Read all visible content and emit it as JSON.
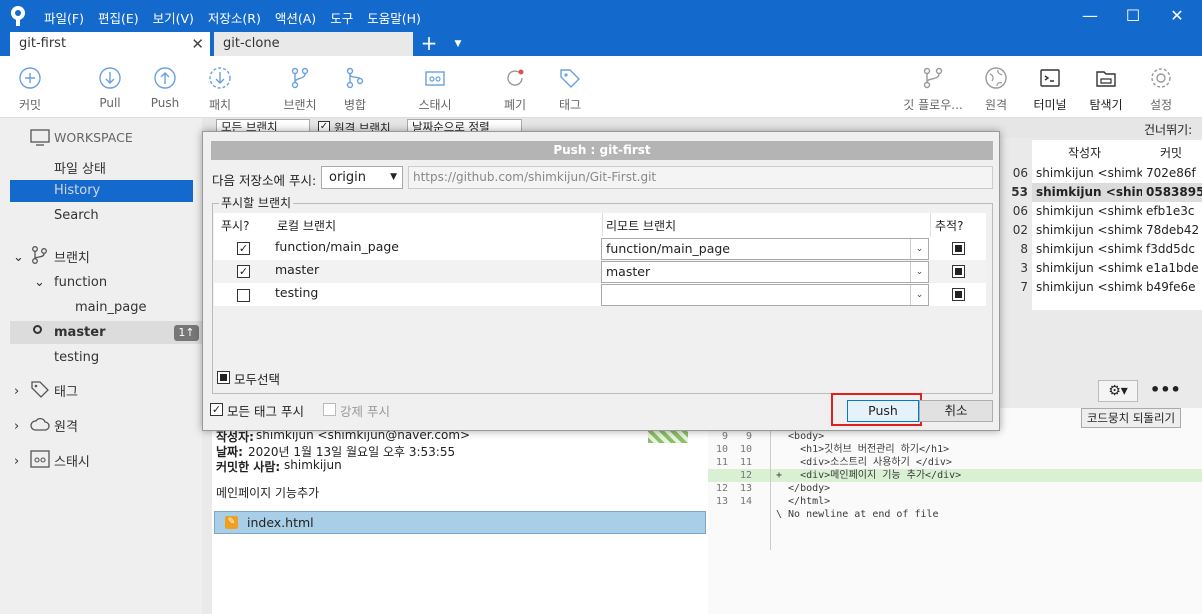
{
  "menu": [
    "파일(F)",
    "편집(E)",
    "보기(V)",
    "저장소(R)",
    "액션(A)",
    "도구",
    "도움말(H)"
  ],
  "tabs": {
    "active": "git-first",
    "inactive": "git-clone"
  },
  "toolbar": {
    "commit": "커밋",
    "pull": "Pull",
    "push": "Push",
    "fetch": "패치",
    "branch": "브랜치",
    "merge": "병합",
    "stash": "스태시",
    "discard": "폐기",
    "tag": "태그",
    "gitflow": "깃 플로우...",
    "remote": "원격",
    "terminal": "터미널",
    "explorer": "탐색기",
    "settings": "설정"
  },
  "sidebar": {
    "workspace": "WORKSPACE",
    "file_status": "파일 상태",
    "history": "History",
    "search": "Search",
    "branches": "브랜치",
    "function": "function",
    "main_page": "main_page",
    "master": "master",
    "master_badge": "1↑",
    "testing": "testing",
    "tags": "태그",
    "remotes": "원격",
    "stashes": "스태시"
  },
  "history": {
    "jump_label": "건너뛰기:",
    "col_author": "작성자",
    "col_commit": "커밋",
    "rows": [
      {
        "d": "06",
        "a": "shimkijun <shimki",
        "c": "702e86f",
        "bold": false
      },
      {
        "d": "53",
        "a": "shimkijun <shimk",
        "c": "0583895",
        "bold": true
      },
      {
        "d": "06",
        "a": "shimkijun <shimki",
        "c": "efb1e3c",
        "bold": false
      },
      {
        "d": "02",
        "a": "shimkijun <shimki",
        "c": "78deb42",
        "bold": false
      },
      {
        "d": "8",
        "a": "shimkijun <shimki",
        "c": "f3dd5dc",
        "bold": false
      },
      {
        "d": "3",
        "a": "shimkijun <shimki",
        "c": "e1a1bde",
        "bold": false
      },
      {
        "d": "7",
        "a": "shimkijun <shimki",
        "c": "b49fe6e",
        "bold": false
      }
    ]
  },
  "filter": {
    "branches": "모든 브랜치",
    "remote": "원격 브랜치",
    "sort": "날짜순으로 정렬"
  },
  "detail": {
    "author_label": "작성자:",
    "author": "shimkijun <shimkijun@naver.com>",
    "date_label": "날짜:",
    "date": "2020년 1월 13일 월요일 오후 3:53:55",
    "committer_label": "커밋한 사람:",
    "committer": "shimkijun",
    "message": "메인페이지 기능추가",
    "file": "index.html"
  },
  "diff": {
    "revert_btn": "코드뭉치 되돌리기",
    "lines": [
      {
        "o": "9",
        "n": "9",
        "t": "  <body>",
        "k": "ctx"
      },
      {
        "o": "10",
        "n": "10",
        "t": "    <h1>깃허브 버전관리 하기</h1>",
        "k": "ctx"
      },
      {
        "o": "11",
        "n": "11",
        "t": "    <div>소스트리 사용하기 </div>",
        "k": "ctx"
      },
      {
        "o": "",
        "n": "12",
        "t": "+   <div>메인페이지 기능 추가</div>",
        "k": "add"
      },
      {
        "o": "12",
        "n": "13",
        "t": "  </body>",
        "k": "ctx"
      },
      {
        "o": "13",
        "n": "14",
        "t": "  </html>",
        "k": "ctx"
      },
      {
        "o": "",
        "n": "",
        "t": "\\ No newline at end of file",
        "k": "ctx"
      }
    ]
  },
  "dialog": {
    "title": "Push :  git-first",
    "push_to_label": "다음 저장소에 푸시:",
    "remote": "origin",
    "remote_url": "https://github.com/shimkijun/Git-First.git",
    "branches_group": "푸시할 브랜치",
    "col_push": "푸시?",
    "col_local": "로컬 브랜치",
    "col_remote": "리모트 브랜치",
    "col_track": "추적?",
    "rows": [
      {
        "push": true,
        "local": "function/main_page",
        "remote": "function/main_page"
      },
      {
        "push": true,
        "local": "master",
        "remote": "master"
      },
      {
        "push": false,
        "local": "testing",
        "remote": ""
      }
    ],
    "select_all": "모두선택",
    "push_all_tags": "모든 태그 푸시",
    "force_push": "강제 푸시",
    "push_button": "Push",
    "cancel_button": "취소"
  },
  "colors": {
    "accent": "#1469cc",
    "highlight": "#e02020"
  }
}
